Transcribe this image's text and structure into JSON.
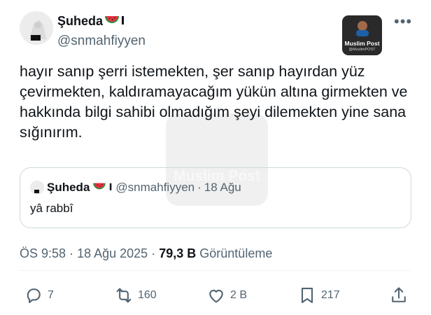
{
  "author": {
    "name": "Şuheda",
    "handle": "@snmahfiyyen"
  },
  "watermark": {
    "title": "Muslim Post",
    "subtitle": "@MuslimPOST",
    "big_text": "Muslim Post"
  },
  "tweet": {
    "text": "hayır sanıp şerri istemekten, şer sanıp hayırdan yüz çevirmekten, kaldıramayacağım yükün altına girmekten ve hakkında bilgi sahibi olmadığım şeyi dilemekten yine sana sığınırım."
  },
  "quoted": {
    "name": "Şuheda",
    "handle": "@snmahfiyyen",
    "separator": "·",
    "date": "18 Ağu",
    "text": "yâ rabbî"
  },
  "meta": {
    "time": "ÖS 9:58",
    "sep1": "·",
    "date": "18 Ağu 2025",
    "sep2": "·",
    "views_count": "79,3 B",
    "views_label": "Görüntüleme"
  },
  "actions": {
    "replies": "7",
    "reposts": "160",
    "likes": "2 B",
    "bookmarks": "217"
  },
  "colors": {
    "text": "#0f1419",
    "secondary": "#536471",
    "border": "#cfd9de"
  },
  "icons": [
    "more-icon",
    "watermelon-icon",
    "reply-icon",
    "repost-icon",
    "like-icon",
    "bookmark-icon",
    "share-icon"
  ]
}
